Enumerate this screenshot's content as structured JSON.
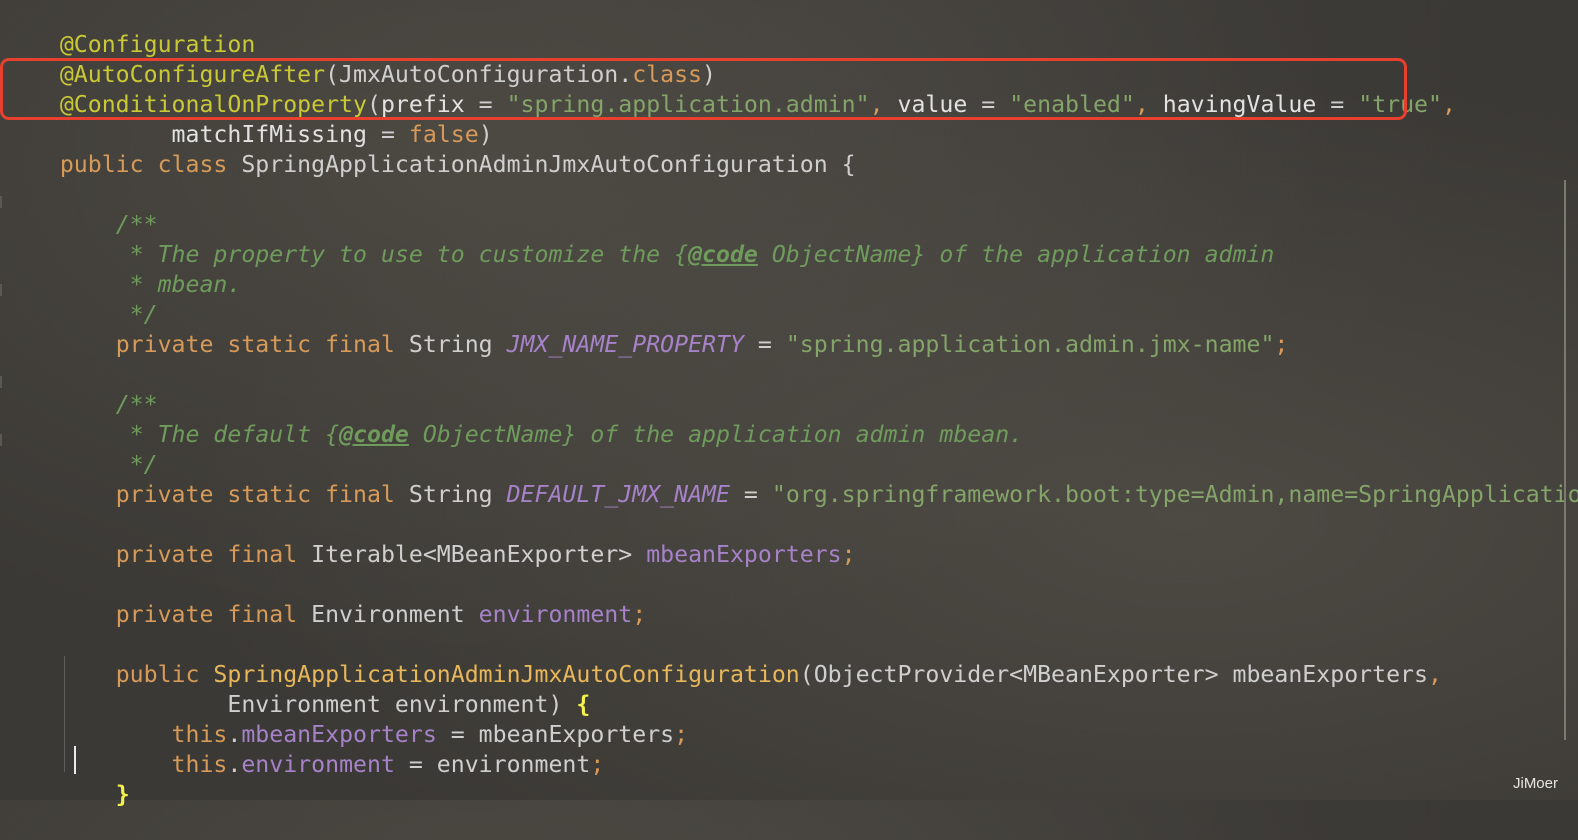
{
  "lines": {
    "l1": {
      "t1": "@Configuration"
    },
    "l2": {
      "t1": "@AutoConfigureAfter",
      "t2": "(JmxAutoConfiguration.",
      "t3": "class",
      "t4": ")"
    },
    "l3": {
      "t1": "@ConditionalOnProperty",
      "t2": "(",
      "t3": "prefix",
      "t4": " = ",
      "t5": "\"spring.application.admin\"",
      "t6": ", ",
      "t7": "value",
      "t8": " = ",
      "t9": "\"enabled\"",
      "t10": ", ",
      "t11": "havingValue",
      "t12": " = ",
      "t13": "\"true\"",
      "t14": ","
    },
    "l4": {
      "t0": "        ",
      "t1": "matchIfMissing",
      "t2": " = ",
      "t3": "false",
      "t4": ")"
    },
    "l5": {
      "t1": "public class ",
      "t2": "SpringApplicationAdminJmxAutoConfiguration {"
    },
    "l7": {
      "t0": "    ",
      "t1": "/**"
    },
    "l8": {
      "t0": "    ",
      "t1": " * The property to use to customize the {",
      "t2": "@code",
      "t3": " ObjectName} of the application admin"
    },
    "l9": {
      "t0": "    ",
      "t1": " * mbean."
    },
    "l10": {
      "t0": "    ",
      "t1": " */"
    },
    "l11": {
      "t0": "    ",
      "t1": "private static final ",
      "t2": "String ",
      "t3": "JMX_NAME_PROPERTY",
      "t4": " = ",
      "t5": "\"spring.application.admin.jmx-name\"",
      "t6": ";"
    },
    "l13": {
      "t0": "    ",
      "t1": "/**"
    },
    "l14": {
      "t0": "    ",
      "t1": " * The default {",
      "t2": "@code",
      "t3": " ObjectName} of the application admin mbean."
    },
    "l15": {
      "t0": "    ",
      "t1": " */"
    },
    "l16": {
      "t0": "    ",
      "t1": "private static final ",
      "t2": "String ",
      "t3": "DEFAULT_JMX_NAME",
      "t4": " = ",
      "t5": "\"org.springframework.boot:type=Admin,name=SpringApplication\"",
      "t6": ";"
    },
    "l18": {
      "t0": "    ",
      "t1": "private final ",
      "t2": "Iterable<MBeanExporter> ",
      "t3": "mbeanExporters",
      "t4": ";"
    },
    "l20": {
      "t0": "    ",
      "t1": "private final ",
      "t2": "Environment ",
      "t3": "environment",
      "t4": ";"
    },
    "l22": {
      "t0": "    ",
      "t1": "public ",
      "t2": "SpringApplicationAdminJmxAutoConfiguration",
      "t3": "(ObjectProvider<MBeanExporter> mbeanExporters",
      "t4": ","
    },
    "l23": {
      "t0": "            ",
      "t1": "Environment environment) ",
      "t2": "{"
    },
    "l24": {
      "t0": "        ",
      "t1": "this",
      "t2": ".",
      "t3": "mbeanExporters",
      "t4": " = mbeanExporters",
      "t5": ";"
    },
    "l25": {
      "t0": "        ",
      "t1": "this",
      "t2": ".",
      "t3": "environment",
      "t4": " = environment",
      "t5": ";"
    },
    "l26": {
      "t0": "    ",
      "t1": "}"
    }
  },
  "watermark": "JiMoer",
  "colors": {
    "annotation": "#c9c936",
    "keyword": "#d79a58",
    "string": "#84a469",
    "comment": "#6f9b5c",
    "constant": "#a682c8",
    "highlight_border": "#e8402e"
  }
}
